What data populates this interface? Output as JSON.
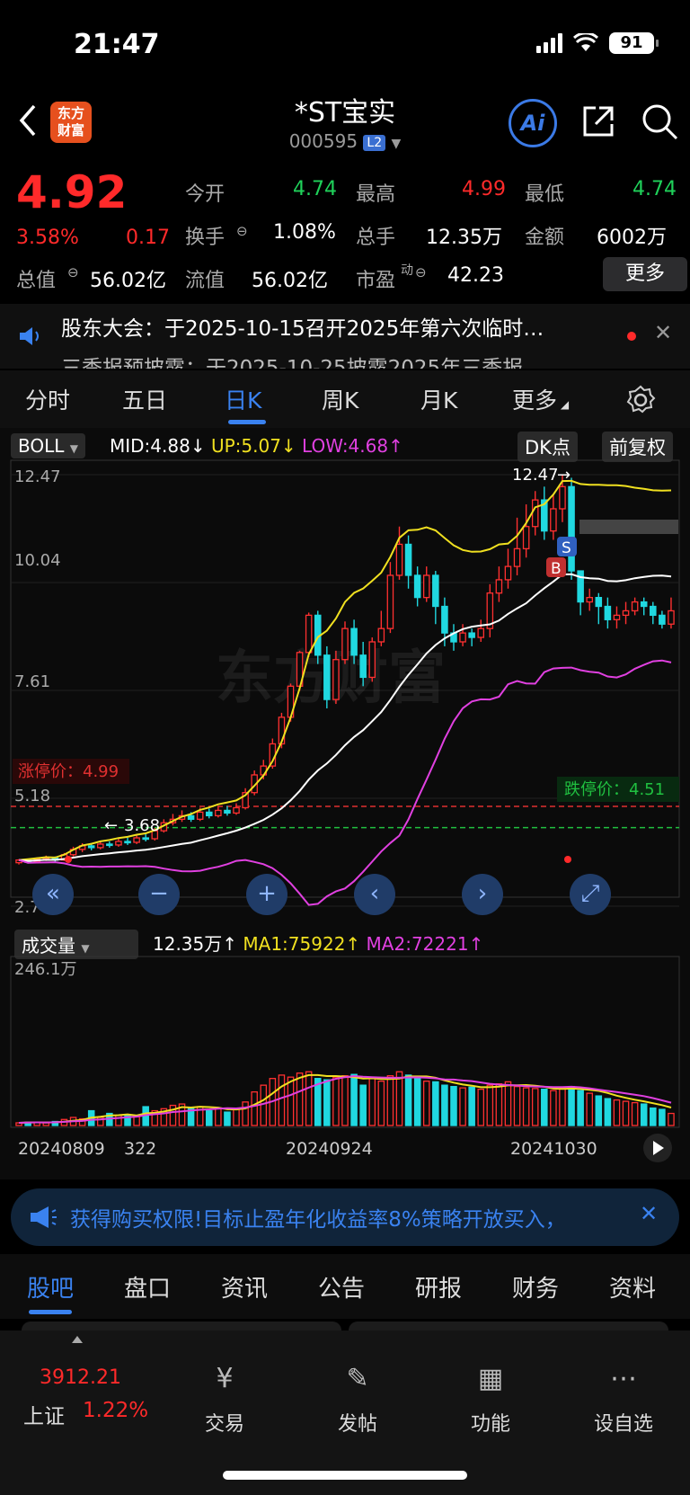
{
  "status_bar": {
    "time": "21:47",
    "battery": "91"
  },
  "header": {
    "title": "*ST宝实",
    "code": "000595",
    "level": "L2",
    "logo": "东方\n财富",
    "ai": "Ai"
  },
  "quote": {
    "price": "4.92",
    "change_pct": "3.58%",
    "change": "0.17",
    "open_label": "今开",
    "open": "4.74",
    "high_label": "最高",
    "high": "4.99",
    "low_label": "最低",
    "low": "4.74",
    "turnover_label": "换手",
    "turnover": "1.08%",
    "volume_label": "总手",
    "volume": "12.35万",
    "amount_label": "金额",
    "amount": "6002万",
    "mktcap_label": "总值",
    "mktcap": "56.02亿",
    "float_label": "流值",
    "float_cap": "56.02亿",
    "pe_label": "市盈",
    "pe_sup": "动",
    "pe": "42.23",
    "more": "更多"
  },
  "notice": {
    "line1": "股东大会：于2025-10-15召开2025年第六次临时…",
    "line2": "三季报预披露：于2025-10-25披露2025年三季报"
  },
  "tabs": [
    "分时",
    "五日",
    "日K",
    "周K",
    "月K",
    "更多"
  ],
  "boll": {
    "name": "BOLL",
    "mid": "MID:4.88",
    "up": "UP:5.07",
    "low": "LOW:4.68",
    "dk": "DK点",
    "adjust": "前复权"
  },
  "chart_labels": {
    "y_ticks": [
      "12.47",
      "10.04",
      "7.61",
      "5.18",
      "2.74"
    ],
    "limit_up": "涨停价：4.99",
    "limit_down": "跌停价：4.51",
    "max_label": "12.47",
    "min_label": "3.68",
    "watermark": "东方财富",
    "sell_mark": "S",
    "buy_mark": "B"
  },
  "volume_panel": {
    "name": "成交量",
    "vol": "12.35万",
    "ma1": "MA1:75922",
    "ma2": "MA2:72221",
    "ymax": "246.1万"
  },
  "dates": [
    "20240809",
    "322",
    "20240924",
    "20241030"
  ],
  "ad": {
    "text": "获得购买权限!目标止盈年化收益率8%策略开放买入，"
  },
  "bottom_tabs": [
    "股吧",
    "盘口",
    "资讯",
    "公告",
    "研报",
    "财务",
    "资料"
  ],
  "footer": {
    "index_value": "3912.21",
    "index_name": "上证",
    "index_change": "1.22%",
    "items": [
      "交易",
      "发帖",
      "功能",
      "设自选"
    ]
  },
  "chart_data": {
    "type": "candlestick",
    "price_axis": [
      2.74,
      12.47
    ],
    "limit_up": 4.99,
    "limit_down": 4.51,
    "candles": [
      [
        3.72,
        3.78,
        3.68,
        3.8
      ],
      [
        3.76,
        3.74,
        3.7,
        3.8
      ],
      [
        3.74,
        3.8,
        3.72,
        3.84
      ],
      [
        3.8,
        3.82,
        3.76,
        3.88
      ],
      [
        3.82,
        3.78,
        3.74,
        3.86
      ],
      [
        3.78,
        3.9,
        3.76,
        3.94
      ],
      [
        3.9,
        4.02,
        3.86,
        4.08
      ],
      [
        4.02,
        4.1,
        3.96,
        4.16
      ],
      [
        4.1,
        4.06,
        4.0,
        4.16
      ],
      [
        4.06,
        4.14,
        4.02,
        4.2
      ],
      [
        4.14,
        4.12,
        4.06,
        4.2
      ],
      [
        4.12,
        4.2,
        4.08,
        4.26
      ],
      [
        4.2,
        4.18,
        4.12,
        4.28
      ],
      [
        4.18,
        4.28,
        4.14,
        4.34
      ],
      [
        4.28,
        4.26,
        4.2,
        4.36
      ],
      [
        4.26,
        4.44,
        4.22,
        4.5
      ],
      [
        4.44,
        4.62,
        4.4,
        4.7
      ],
      [
        4.62,
        4.7,
        4.56,
        4.82
      ],
      [
        4.7,
        4.78,
        4.64,
        4.9
      ],
      [
        4.78,
        4.7,
        4.64,
        4.86
      ],
      [
        4.7,
        4.86,
        4.66,
        4.96
      ],
      [
        4.86,
        4.78,
        4.72,
        4.94
      ],
      [
        4.78,
        4.9,
        4.74,
        4.98
      ],
      [
        4.9,
        4.84,
        4.78,
        5.0
      ],
      [
        4.84,
        4.96,
        4.8,
        5.06
      ],
      [
        4.96,
        5.3,
        4.92,
        5.4
      ],
      [
        5.3,
        5.7,
        5.24,
        5.8
      ],
      [
        5.7,
        5.9,
        5.6,
        6.04
      ],
      [
        5.9,
        6.4,
        5.84,
        6.52
      ],
      [
        6.4,
        7.0,
        6.3,
        7.1
      ],
      [
        7.0,
        7.7,
        6.9,
        7.76
      ],
      [
        7.7,
        8.46,
        7.6,
        8.5
      ],
      [
        8.46,
        9.3,
        8.36,
        9.36
      ],
      [
        9.3,
        8.4,
        8.2,
        9.4
      ],
      [
        8.4,
        7.4,
        7.2,
        8.6
      ],
      [
        7.4,
        8.3,
        7.3,
        8.5
      ],
      [
        8.3,
        9.0,
        8.2,
        9.16
      ],
      [
        9.0,
        8.4,
        8.2,
        9.2
      ],
      [
        8.4,
        7.9,
        7.7,
        8.7
      ],
      [
        7.9,
        8.7,
        7.8,
        8.8
      ],
      [
        8.7,
        9.0,
        8.6,
        9.4
      ],
      [
        9.0,
        10.2,
        8.9,
        10.5
      ],
      [
        10.2,
        10.9,
        10.1,
        11.3
      ],
      [
        10.9,
        10.2,
        9.9,
        11.1
      ],
      [
        10.2,
        9.7,
        9.5,
        10.4
      ],
      [
        9.7,
        10.2,
        9.6,
        10.4
      ],
      [
        10.2,
        9.5,
        9.1,
        10.3
      ],
      [
        9.5,
        8.9,
        8.6,
        9.7
      ],
      [
        8.9,
        8.7,
        8.5,
        9.1
      ],
      [
        8.7,
        8.9,
        8.6,
        9.1
      ],
      [
        8.9,
        8.8,
        8.6,
        9.0
      ],
      [
        8.8,
        9.0,
        8.7,
        9.2
      ],
      [
        9.0,
        9.8,
        8.8,
        10.0
      ],
      [
        9.8,
        10.1,
        9.6,
        10.4
      ],
      [
        10.1,
        10.4,
        9.9,
        10.8
      ],
      [
        10.4,
        10.8,
        10.2,
        11.5
      ],
      [
        10.8,
        11.3,
        10.6,
        11.8
      ],
      [
        11.3,
        11.9,
        11.1,
        12.1
      ],
      [
        11.9,
        11.2,
        11.0,
        12.2
      ],
      [
        11.2,
        11.7,
        11.0,
        12.0
      ],
      [
        11.7,
        12.2,
        11.4,
        12.47
      ],
      [
        12.2,
        10.3,
        10.1,
        12.4
      ],
      [
        10.3,
        9.6,
        9.3,
        10.3
      ],
      [
        9.6,
        9.7,
        9.4,
        9.9
      ],
      [
        9.7,
        9.5,
        9.1,
        9.8
      ],
      [
        9.5,
        9.2,
        9.0,
        9.7
      ],
      [
        9.2,
        9.3,
        9.0,
        9.5
      ],
      [
        9.3,
        9.4,
        9.1,
        9.6
      ],
      [
        9.4,
        9.6,
        9.3,
        9.7
      ],
      [
        9.6,
        9.5,
        9.3,
        9.7
      ],
      [
        9.5,
        9.3,
        9.1,
        9.6
      ],
      [
        9.3,
        9.1,
        9.0,
        9.4
      ],
      [
        9.1,
        9.4,
        9.0,
        9.7
      ]
    ],
    "volume_max_wan": 246.1,
    "volumes": [
      4,
      5,
      5,
      4,
      6,
      9,
      12,
      10,
      22,
      12,
      18,
      15,
      16,
      13,
      28,
      22,
      25,
      30,
      32,
      25,
      28,
      22,
      26,
      20,
      24,
      35,
      50,
      60,
      70,
      75,
      72,
      78,
      80,
      70,
      68,
      72,
      74,
      76,
      60,
      70,
      66,
      74,
      80,
      75,
      70,
      66,
      65,
      60,
      58,
      56,
      57,
      54,
      60,
      62,
      65,
      58,
      56,
      55,
      54,
      52,
      56,
      58,
      52,
      48,
      44,
      40,
      38,
      36,
      34,
      32,
      26,
      24,
      18
    ]
  }
}
